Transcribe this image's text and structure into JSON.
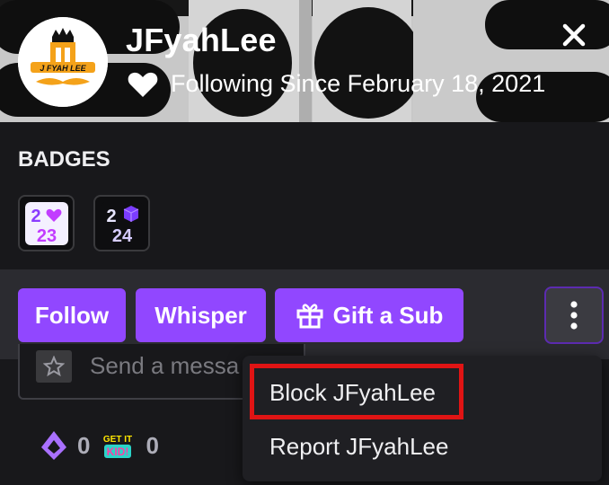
{
  "header": {
    "username": "JFyahLee",
    "follow_text": "Following Since February 18, 2021",
    "avatar_text": "J FYAH LEE"
  },
  "badges": {
    "title": "BADGES",
    "items": [
      {
        "top": "2",
        "top2": "",
        "bottom": "23",
        "icon": "heart-2023-badge"
      },
      {
        "top": "2",
        "top2": "",
        "bottom": "24",
        "icon": "cube-2024-badge"
      }
    ]
  },
  "actions": {
    "follow": "Follow",
    "whisper": "Whisper",
    "gift": "Gift a Sub"
  },
  "chat": {
    "placeholder": "Send a messa"
  },
  "points": {
    "channel_points": "0",
    "emote_points": "0",
    "emote_text": "GET IT KID!"
  },
  "menu": {
    "block": "Block JFyahLee",
    "report": "Report JFyahLee"
  },
  "colors": {
    "accent": "#9147ff",
    "highlight": "#e01414"
  }
}
